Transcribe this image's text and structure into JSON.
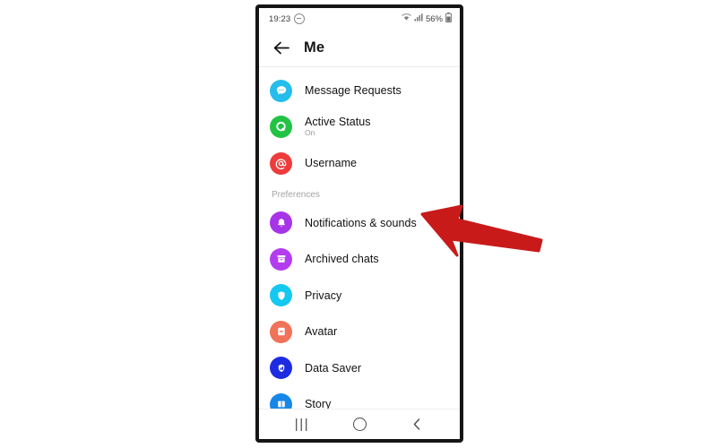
{
  "status_bar": {
    "time": "19:23",
    "dnd_icon": "do-not-disturb-icon",
    "wifi_icon": "wifi-icon",
    "signal_icon": "cellular-signal-icon",
    "battery_percent": "56%",
    "battery_icon": "battery-icon"
  },
  "header": {
    "back_icon": "back-arrow-icon",
    "title": "Me"
  },
  "list": [
    {
      "type": "item",
      "name": "message-requests",
      "label": "Message Requests",
      "sub": "",
      "icon": "message-bubble-icon",
      "color": "#24bdec"
    },
    {
      "type": "item",
      "name": "active-status",
      "label": "Active Status",
      "sub": "On",
      "icon": "active-status-icon",
      "color": "#22c345"
    },
    {
      "type": "item",
      "name": "username",
      "label": "Username",
      "sub": "",
      "icon": "at-sign-icon",
      "color": "#ee3b3b"
    },
    {
      "type": "header",
      "name": "preferences-section-header",
      "label": "Preferences"
    },
    {
      "type": "item",
      "name": "notifications-and-sounds",
      "label": "Notifications & sounds",
      "sub": "",
      "icon": "bell-icon",
      "color": "#a734e8"
    },
    {
      "type": "item",
      "name": "archived-chats",
      "label": "Archived chats",
      "sub": "",
      "icon": "archive-box-icon",
      "color": "#b43cf0"
    },
    {
      "type": "item",
      "name": "privacy",
      "label": "Privacy",
      "sub": "",
      "icon": "shield-icon",
      "color": "#14c8f0"
    },
    {
      "type": "item",
      "name": "avatar",
      "label": "Avatar",
      "sub": "",
      "icon": "avatar-face-icon",
      "color": "#f07258"
    },
    {
      "type": "item",
      "name": "data-saver",
      "label": "Data Saver",
      "sub": "",
      "icon": "data-saver-shield-icon",
      "color": "#1d2ce0"
    },
    {
      "type": "item",
      "name": "story",
      "label": "Story",
      "sub": "",
      "icon": "story-book-icon",
      "color": "#1787e8"
    }
  ],
  "nav_bar": {
    "recents_label": "|||",
    "recents_icon": "recents-icon",
    "home_icon": "home-icon",
    "back_icon": "back-icon"
  },
  "annotation": {
    "arrow_icon": "red-pointer-arrow",
    "color": "#c91a1a",
    "points_to": "Notifications & sounds"
  }
}
